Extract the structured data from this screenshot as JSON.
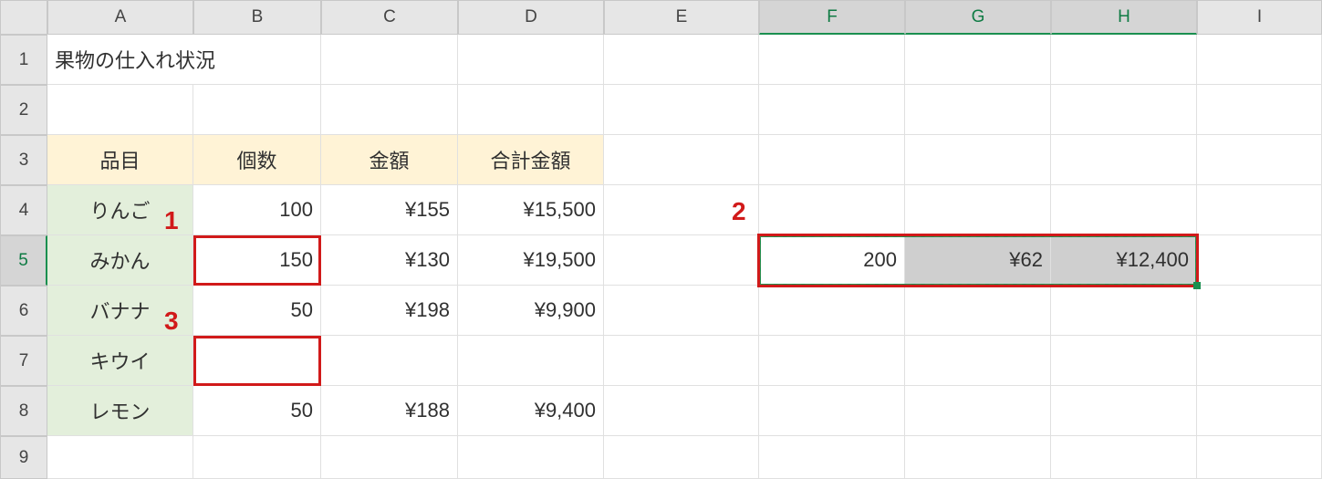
{
  "columns": [
    "A",
    "B",
    "C",
    "D",
    "E",
    "F",
    "G",
    "H",
    "I"
  ],
  "rows": [
    "1",
    "2",
    "3",
    "4",
    "5",
    "6",
    "7",
    "8",
    "9"
  ],
  "title": "果物の仕入れ状況",
  "headers": {
    "A3": "品目",
    "B3": "個数",
    "C3": "金額",
    "D3": "合計金額"
  },
  "items": {
    "A4": "りんご",
    "A5": "みかん",
    "A6": "バナナ",
    "A7": "キウイ",
    "A8": "レモン"
  },
  "qty": {
    "B4": "100",
    "B5": "150",
    "B6": "50",
    "B7": "",
    "B8": "50"
  },
  "price": {
    "C4": "¥155",
    "C5": "¥130",
    "C6": "¥198",
    "C7": "",
    "C8": "¥188"
  },
  "total": {
    "D4": "¥15,500",
    "D5": "¥19,500",
    "D6": "¥9,900",
    "D7": "",
    "D8": "¥9,400"
  },
  "side": {
    "F5": "200",
    "G5": "¥62",
    "H5": "¥12,400"
  },
  "callouts": {
    "c1": "1",
    "c2": "2",
    "c3": "3"
  }
}
